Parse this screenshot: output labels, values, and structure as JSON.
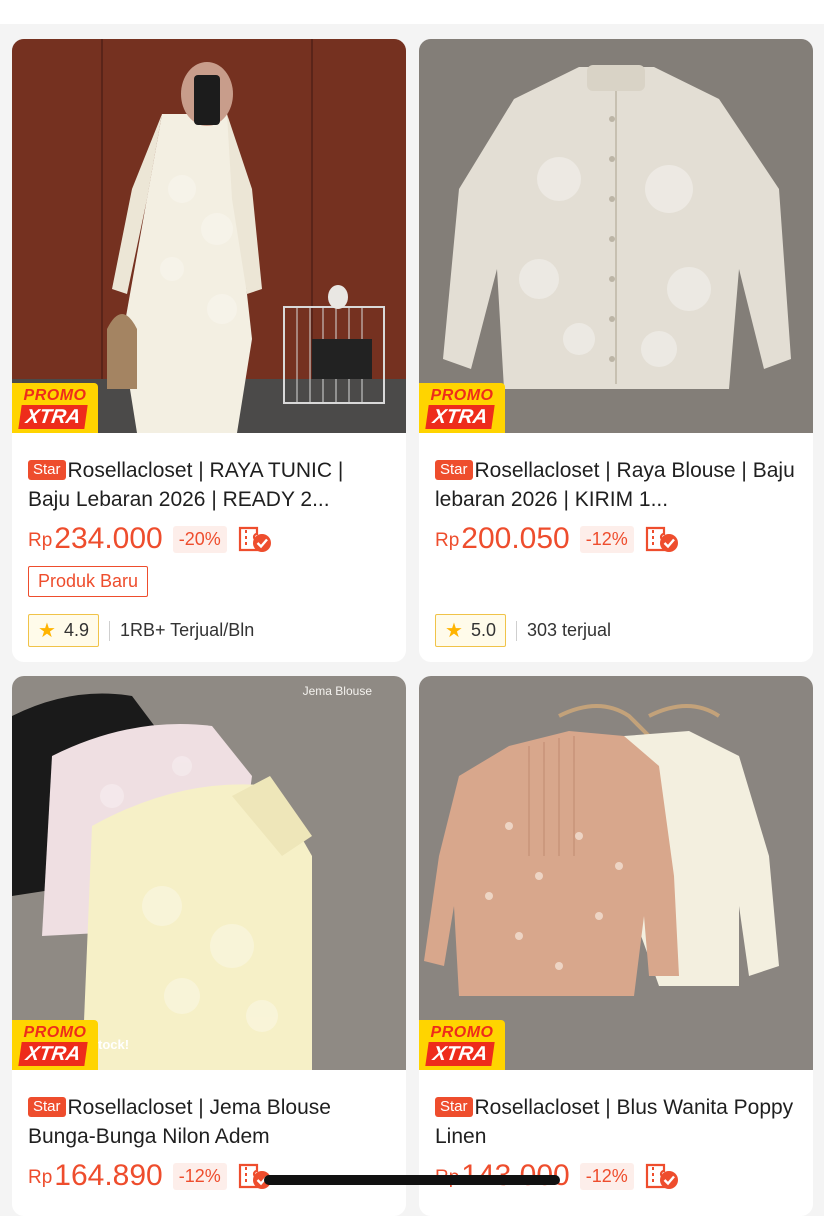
{
  "products": [
    {
      "star_badge": "Star",
      "title": "Rosellacloset | RAYA TUNIC | Baju Lebaran 2026 | READY 2...",
      "currency": "Rp",
      "price": "234.000",
      "discount": "-20%",
      "tag": "Produk Baru",
      "rating": "4.9",
      "sold": "1RB+ Terjual/Bln",
      "promo_top": "PROMO",
      "promo_bottom": "XTRA"
    },
    {
      "star_badge": "Star",
      "title": "Rosellacloset | Raya Blouse | Baju lebaran 2026 | KIRIM 1...",
      "currency": "Rp",
      "price": "200.050",
      "discount": "-12%",
      "rating": "5.0",
      "sold": "303 terjual",
      "promo_top": "PROMO",
      "promo_bottom": "XTRA"
    },
    {
      "star_badge": "Star",
      "title": "Rosellacloset | Jema Blouse Bunga-Bunga Nilon Adem",
      "currency": "Rp",
      "price": "164.890",
      "discount": "-12%",
      "image_caption": "Jema Blouse",
      "image_text_partial": "tock!",
      "promo_top": "PROMO",
      "promo_bottom": "XTRA"
    },
    {
      "star_badge": "Star",
      "title": "Rosellacloset | Blus Wanita Poppy Linen",
      "currency": "Rp",
      "price": "143.000",
      "discount": "-12%",
      "promo_top": "PROMO",
      "promo_bottom": "XTRA"
    }
  ],
  "colors": {
    "accent": "#ee4d2d",
    "promo_yellow": "#ffd400",
    "rating_star": "#ffb400"
  },
  "icons": {
    "cod": "cod-check-icon",
    "rating": "star-icon"
  }
}
